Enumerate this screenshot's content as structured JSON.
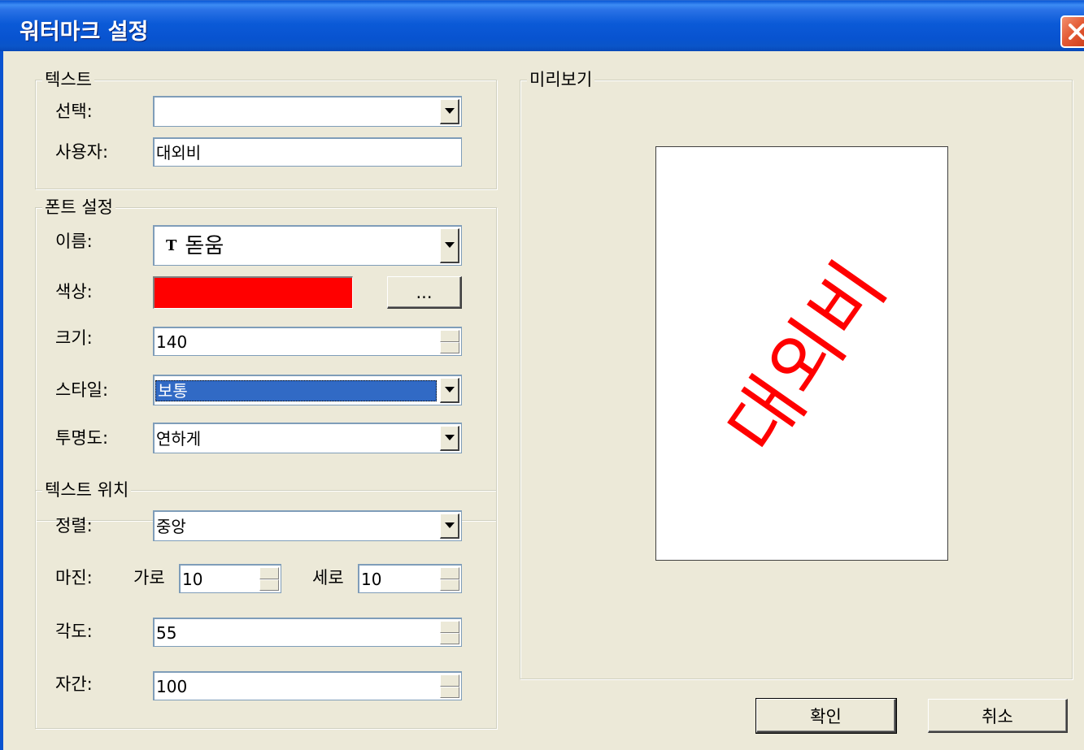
{
  "window": {
    "title": "워터마크 설정"
  },
  "text_group": {
    "legend": "텍스트",
    "select_label": "선택:",
    "select_value": "",
    "user_label": "사용자:",
    "user_value": "대외비"
  },
  "font_group": {
    "legend": "폰트 설정",
    "name_label": "이름:",
    "name_value": "돋움",
    "color_label": "색상:",
    "color_value": "#FF0000",
    "color_button": "...",
    "size_label": "크기:",
    "size_value": "140",
    "style_label": "스타일:",
    "style_value": "보통",
    "transparency_label": "투명도:",
    "transparency_value": "연하게"
  },
  "position_group": {
    "legend": "텍스트 위치",
    "align_label": "정렬:",
    "align_value": "중앙",
    "margin_label": "마진:",
    "horizontal_label": "가로",
    "horizontal_value": "10",
    "vertical_label": "세로",
    "vertical_value": "10",
    "angle_label": "각도:",
    "angle_value": "55",
    "spacing_label": "자간:",
    "spacing_value": "100"
  },
  "preview": {
    "legend": "미리보기",
    "watermark_text": "대외비"
  },
  "buttons": {
    "ok": "확인",
    "cancel": "취소"
  }
}
